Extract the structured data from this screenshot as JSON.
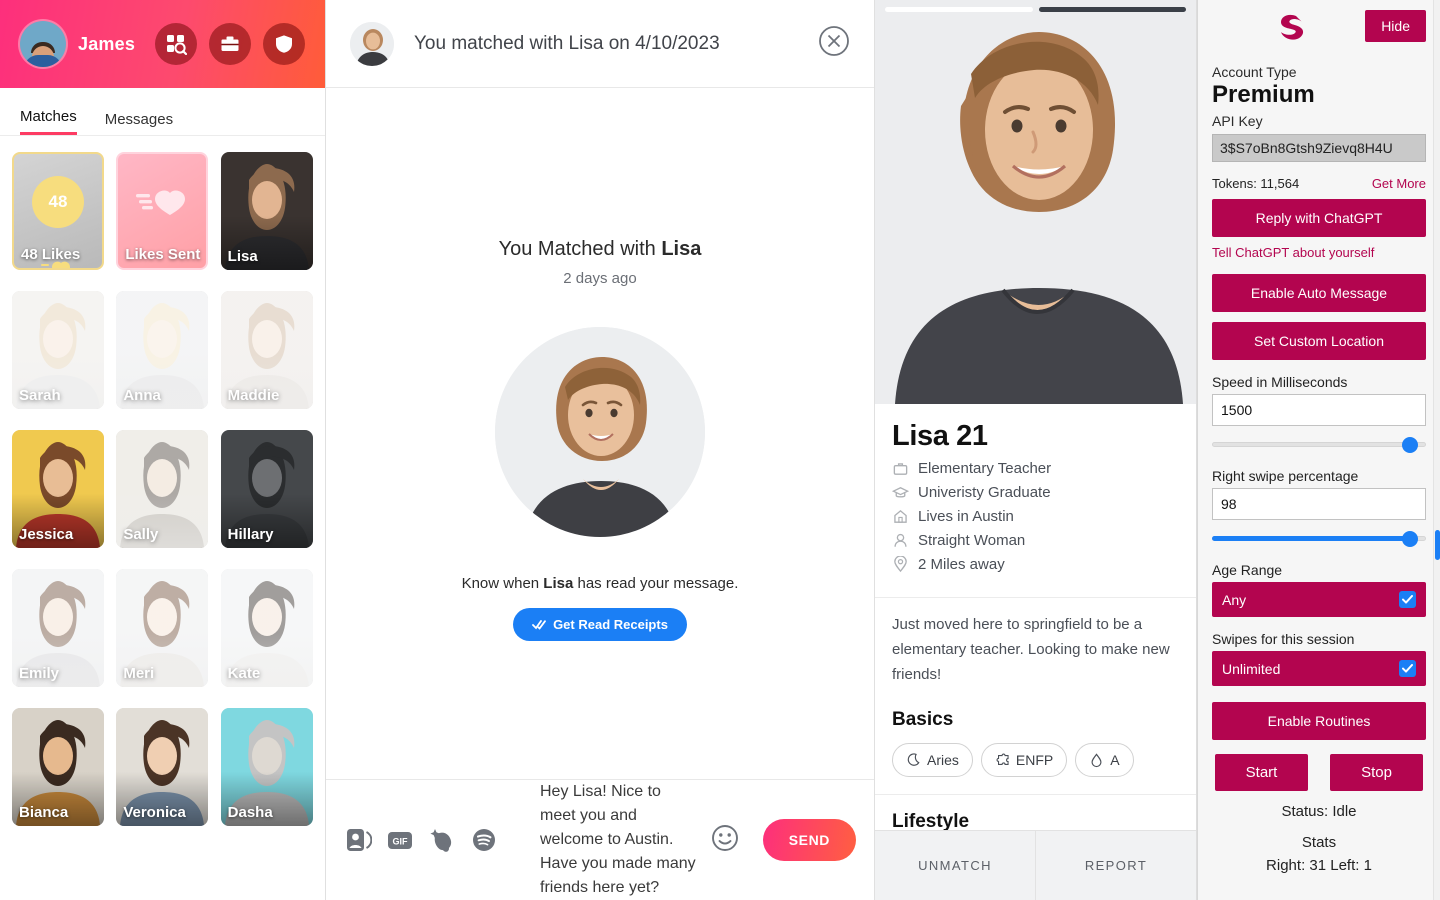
{
  "left": {
    "user_name": "James",
    "header_icons": [
      {
        "name": "discover-search-icon",
        "label": "Discover"
      },
      {
        "name": "briefcase-icon",
        "label": "Explore"
      },
      {
        "name": "shield-icon",
        "label": "Safety"
      }
    ],
    "tabs": [
      {
        "label": "Matches",
        "active": true
      },
      {
        "label": "Messages",
        "active": false
      }
    ],
    "cards": [
      {
        "kind": "likes",
        "count": "48",
        "label": "48 Likes"
      },
      {
        "kind": "sent",
        "label": "Likes Sent"
      },
      {
        "kind": "photo",
        "label": "Lisa",
        "tone": "dark",
        "bg": "#3a3330",
        "hair": "#8d6a4e",
        "skin": "#e2b592",
        "shirt": "#2e2e31"
      },
      {
        "kind": "photo",
        "label": "Sarah",
        "tone": "faded",
        "bg": "#e9e6e2",
        "hair": "#e2cfb0",
        "skin": "#f3e2d3",
        "shirt": "#dcdcdc"
      },
      {
        "kind": "photo",
        "label": "Anna",
        "tone": "faded",
        "bg": "#e6e8ea",
        "hair": "#f0e2c4",
        "skin": "#f5e6d7",
        "shirt": "#d7d7d9"
      },
      {
        "kind": "photo",
        "label": "Maddie",
        "tone": "faded",
        "bg": "#e8e2dd",
        "hair": "#cbb49c",
        "skin": "#f2e0d1",
        "shirt": "#d9d2cb"
      },
      {
        "kind": "photo",
        "label": "Jessica",
        "tone": "color",
        "bg": "#f0c94f",
        "hair": "#7a4a2a",
        "skin": "#e8bd95",
        "shirt": "#c0392b"
      },
      {
        "kind": "photo",
        "label": "Sally",
        "tone": "faded",
        "bg": "#ddd9cf",
        "hair": "#4a4038",
        "skin": "#e6d4c2",
        "shirt": "#9a9386"
      },
      {
        "kind": "photo",
        "label": "Hillary",
        "tone": "dark",
        "bg": "#45484b",
        "hair": "#2b2d2f",
        "skin": "#6d6f72",
        "shirt": "#3a3d40"
      },
      {
        "kind": "photo",
        "label": "Emily",
        "tone": "faded",
        "bg": "#e7e9eb",
        "hair": "#6b4a35",
        "skin": "#f2ddcb",
        "shirt": "#cfcfd2"
      },
      {
        "kind": "photo",
        "label": "Meri",
        "tone": "faded",
        "bg": "#e9eaec",
        "hair": "#6e4c36",
        "skin": "#f4e2d2",
        "shirt": "#ddd8d3"
      },
      {
        "kind": "photo",
        "label": "Kate",
        "tone": "faded",
        "bg": "#eceeef",
        "hair": "#2f2824",
        "skin": "#f2e1d2",
        "shirt": "#e6e4e2"
      },
      {
        "kind": "photo",
        "label": "Bianca",
        "tone": "color",
        "bg": "#d8d2c8",
        "hair": "#3a2a20",
        "skin": "#e6b98e",
        "shirt": "#c98a3c"
      },
      {
        "kind": "photo",
        "label": "Veronica",
        "tone": "color",
        "bg": "#e2ded7",
        "hair": "#4b3426",
        "skin": "#f0cfb2",
        "shirt": "#7d94ad"
      },
      {
        "kind": "photo",
        "label": "Dasha",
        "tone": "color",
        "bg": "#7fd8e0",
        "hair": "#c4c4c4",
        "skin": "#ded9d2",
        "shirt": "#bdbdbd"
      }
    ]
  },
  "chat": {
    "header_title": "You matched with Lisa on 4/10/2023",
    "close_icon": "close-circle-icon",
    "matched_prefix": "You Matched with ",
    "matched_name": "Lisa",
    "matched_ago": "2 days ago",
    "read_note_prefix": "Know when ",
    "read_note_name": "Lisa",
    "read_note_suffix": " has read your message.",
    "read_receipts_button": "Get Read Receipts",
    "composer_icons": [
      {
        "name": "sticker-icon",
        "label": "Stickers"
      },
      {
        "name": "gif-icon",
        "label": "GIF"
      },
      {
        "name": "sparkle-icon",
        "label": "Effects"
      },
      {
        "name": "spotify-icon",
        "label": "Spotify"
      }
    ],
    "draft_message": "Hey Lisa! Nice to meet you and welcome to Austin. Have you made many friends here yet?",
    "emoji_icon": "emoji-smile-icon",
    "send_label": "SEND"
  },
  "profile": {
    "carousel": [
      "on",
      "off"
    ],
    "name_age": "Lisa 21",
    "details": [
      {
        "icon": "briefcase-icon",
        "text": "Elementary Teacher"
      },
      {
        "icon": "graduation-cap-icon",
        "text": "Univeristy Graduate"
      },
      {
        "icon": "home-icon",
        "text": "Lives in Austin"
      },
      {
        "icon": "person-icon",
        "text": "Straight Woman"
      },
      {
        "icon": "location-pin-icon",
        "text": "2 Miles away"
      }
    ],
    "bio": "Just moved here to springfield to be a elementary teacher. Looking to make new friends!",
    "basics_title": "Basics",
    "chips": [
      {
        "icon": "moon-icon",
        "label": "Aries"
      },
      {
        "icon": "puzzle-icon",
        "label": "ENFP"
      },
      {
        "icon": "droplet-icon",
        "label": "A"
      }
    ],
    "lifestyle_title": "Lifestyle",
    "actions": [
      {
        "label": "UNMATCH",
        "name": "unmatch-button"
      },
      {
        "label": "REPORT",
        "name": "report-button"
      }
    ]
  },
  "sidebar": {
    "logo": "swipe-s-logo",
    "hide_label": "Hide",
    "account_type_label": "Account Type",
    "account_type_value": "Premium",
    "api_key_label": "API Key",
    "api_key_value": "3$S7oBn8Gtsh9Zievq8H4U",
    "tokens_label": "Tokens: 11,564",
    "get_more_label": "Get More",
    "reply_chatgpt_label": "Reply with ChatGPT",
    "tell_chatgpt_label": "Tell ChatGPT about yourself",
    "auto_message_label": "Enable Auto Message",
    "custom_location_label": "Set Custom Location",
    "speed_label": "Speed in Milliseconds",
    "speed_value": "1500",
    "speed_percent": 96,
    "speed_filled": false,
    "right_swipe_label": "Right swipe percentage",
    "right_swipe_value": "98",
    "right_swipe_percent": 96,
    "right_swipe_filled": true,
    "age_range_label": "Age Range",
    "age_range_value": "Any",
    "swipes_label": "Swipes for this session",
    "swipes_value": "Unlimited",
    "routines_label": "Enable Routines",
    "start_label": "Start",
    "stop_label": "Stop",
    "status_label": "Status: Idle",
    "stats_title": "Stats",
    "stats_line": "Right: 31   Left: 1",
    "accent": "#b3054f",
    "checkbox_color": "#1b7ff5"
  }
}
